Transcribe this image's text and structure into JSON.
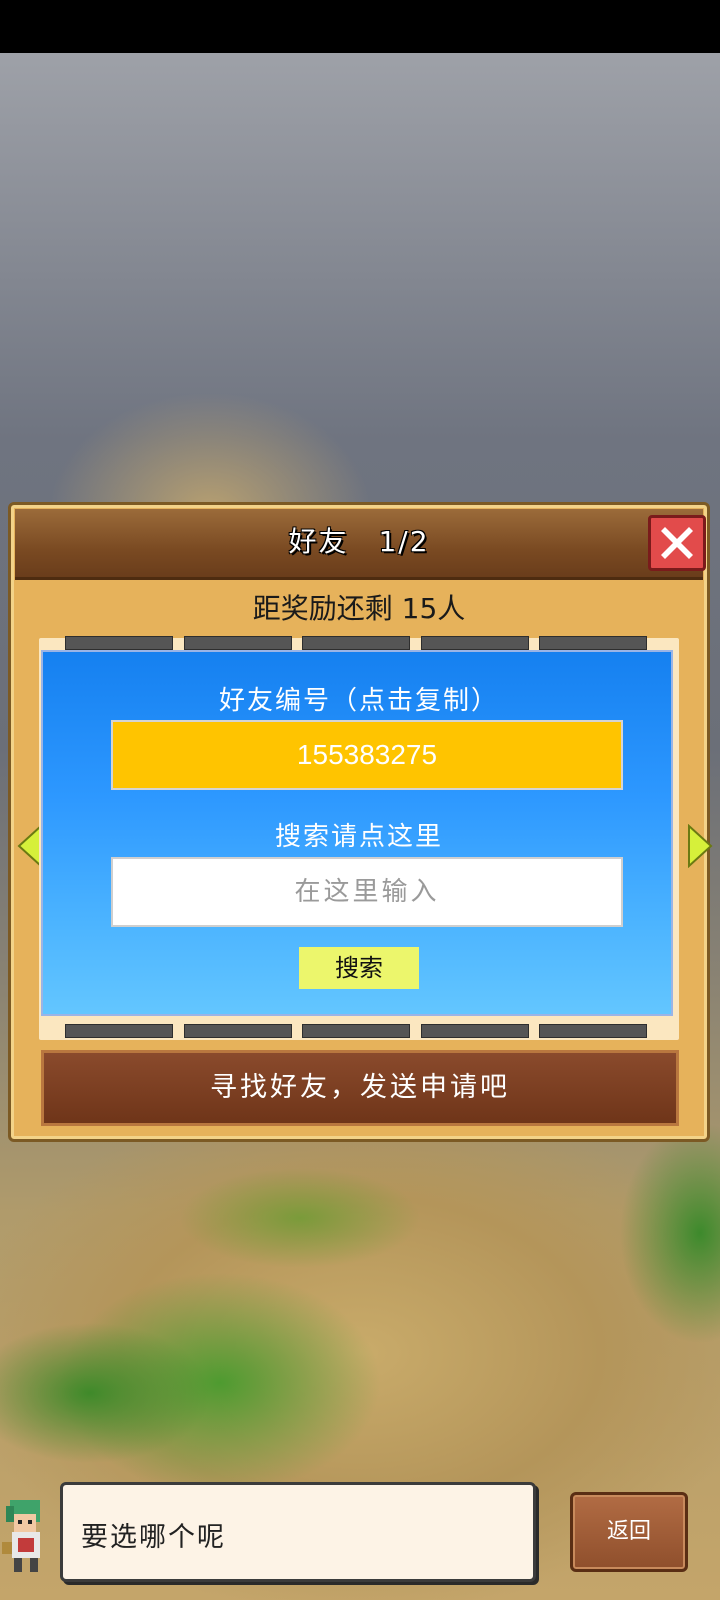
{
  "dialog": {
    "title": "好友　1/2",
    "reward_text": "距奖励还剩 15人",
    "friend_id_label": "好友编号（点击复制）",
    "friend_id_value": "155383275",
    "search_label": "搜索请点这里",
    "search_placeholder": "在这里输入",
    "search_button": "搜索",
    "find_button": "寻找好友，发送申请吧"
  },
  "footer": {
    "speech_text": "要选哪个呢",
    "back_button": "返回"
  },
  "colors": {
    "id_box": "#ffc400",
    "search_button": "#ecf66c",
    "panel_blue": "#2d98ff",
    "close_red": "#e24b4b",
    "dialog_wood": "#e6b25b"
  },
  "icons": {
    "close": "close-x-icon",
    "left_arrow": "left-arrow-icon",
    "right_arrow": "right-arrow-icon"
  }
}
